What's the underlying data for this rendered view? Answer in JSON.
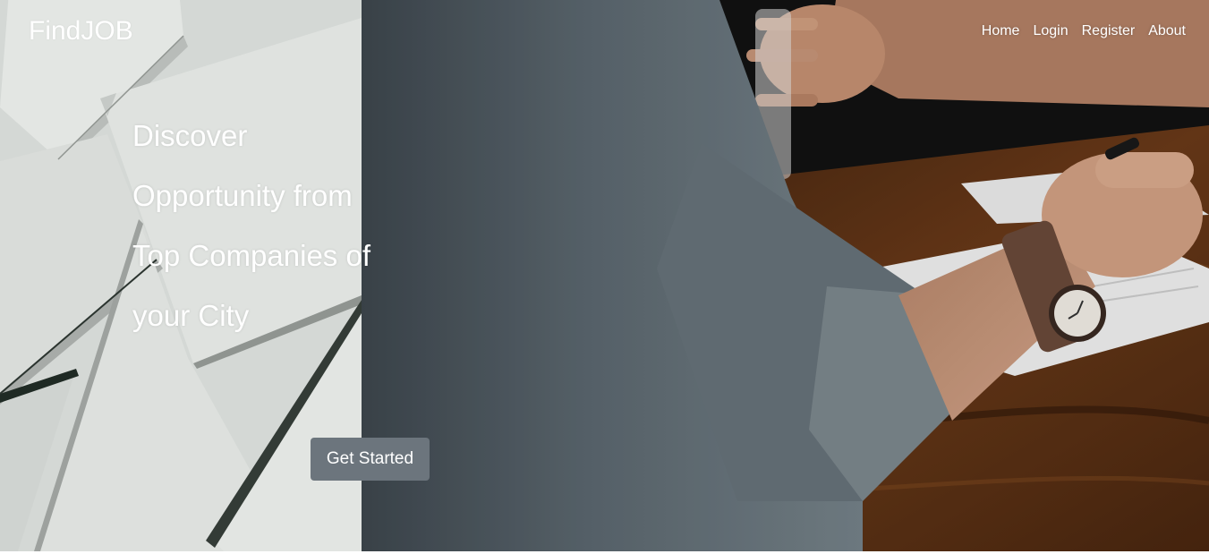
{
  "brand": {
    "name": "FindJOB"
  },
  "nav": {
    "items": [
      "Home",
      "Login",
      "Register",
      "About"
    ]
  },
  "hero": {
    "headline": "Discover Opportunity from Top Companies of your City",
    "cta_label": "Get Started",
    "left_image": "paper-sheets-texture",
    "right_image": "person-writing-at-desk-photo"
  },
  "colors": {
    "cta_background": "#6c757d",
    "text": "#ffffff",
    "left_panel": "#d6dad7",
    "right_panel_shirt": "#58636b",
    "table_wood": "#5a3016"
  }
}
